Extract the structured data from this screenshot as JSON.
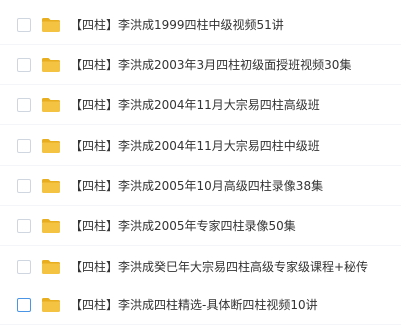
{
  "files": [
    {
      "name": "【四柱】李洪成1999四柱中级视频51讲",
      "icon": "folder-icon"
    },
    {
      "name": "【四柱】李洪成2003年3月四柱初级面授班视频30集",
      "icon": "folder-icon"
    },
    {
      "name": "【四柱】李洪成2004年11月大宗易四柱高级班",
      "icon": "folder-icon"
    },
    {
      "name": "【四柱】李洪成2004年11月大宗易四柱中级班",
      "icon": "folder-icon"
    },
    {
      "name": "【四柱】李洪成2005年10月高级四柱录像38集",
      "icon": "folder-icon"
    },
    {
      "name": "【四柱】李洪成2005年专家四柱录像50集",
      "icon": "folder-icon"
    },
    {
      "name": "【四柱】李洪成癸巳年大宗易四柱高级专家级课程+秘传",
      "icon": "folder-icon"
    },
    {
      "name": "【四柱】李洪成四柱精选-具体断四柱视频10讲",
      "icon": "folder-icon"
    }
  ],
  "colors": {
    "folder": "#f5c342",
    "folder_dark": "#e9ae20",
    "checkbox_border": "#cfd6e0",
    "checkbox_hover_border": "#4a95e6",
    "text": "#333333"
  }
}
